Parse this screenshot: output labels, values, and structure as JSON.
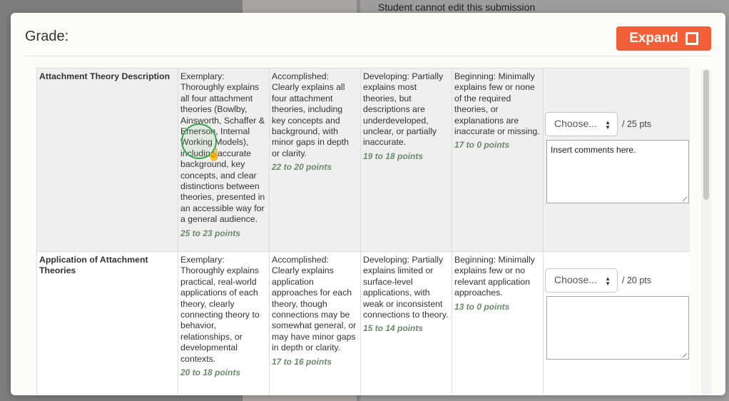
{
  "background": {
    "note": "Student cannot edit this submission"
  },
  "modal": {
    "title": "Grade:",
    "expand_label": "Expand"
  },
  "criteria": [
    {
      "name": "Attachment Theory Description",
      "ratings": [
        {
          "desc": "Exemplary: Thoroughly explains all four attachment theories (Bowlby, Ainsworth, Schaffer & Emerson, Internal Working Models), including accurate background, key concepts, and clear distinctions between theories, presented in an accessible way for a general audience.",
          "points": "25 to 23 points"
        },
        {
          "desc": "Accomplished: Clearly explains all four attachment theories, including key concepts and background, with minor gaps in depth or clarity.",
          "points": "22 to 20 points"
        },
        {
          "desc": "Developing: Partially explains most theories, but descriptions are underdeveloped, unclear, or partially inaccurate.",
          "points": "19 to 18 points"
        },
        {
          "desc": "Beginning: Minimally explains few or none of the required theories, or explanations are inaccurate or missing.",
          "points": "17 to 0 points"
        }
      ],
      "select_value": "Choose...",
      "out_of": "/ 25 pts",
      "comment": "Insert comments here."
    },
    {
      "name": "Application of Attachment Theories",
      "ratings": [
        {
          "desc": "Exemplary: Thoroughly explains practical, real-world applications of each theory, clearly connecting theory to behavior, relationships, or developmental contexts.",
          "points": "20 to 18 points"
        },
        {
          "desc": "Accomplished: Clearly explains application approaches for each theory, though connections may be somewhat general, or may have minor gaps in depth or clarity.",
          "points": "17 to 16 points"
        },
        {
          "desc": "Developing: Partially explains limited or surface-level applications, with weak or inconsistent connections to theory.",
          "points": "15 to 14 points"
        },
        {
          "desc": "Beginning: Minimally explains few or no relevant application approaches.",
          "points": "13 to 0 points"
        }
      ],
      "select_value": "Choose...",
      "out_of": "/ 20 pts",
      "comment": ""
    }
  ]
}
